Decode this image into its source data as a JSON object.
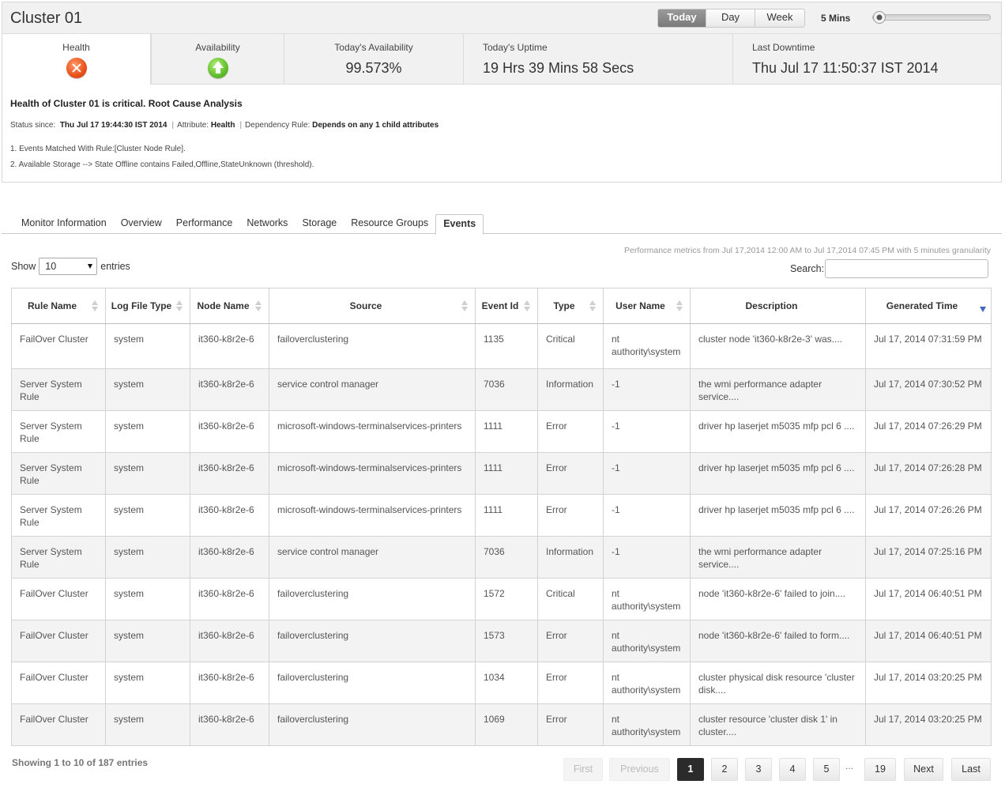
{
  "header": {
    "title": "Cluster 01",
    "range_buttons": [
      {
        "label": "Today"
      },
      {
        "label": "Day"
      },
      {
        "label": "Week"
      }
    ],
    "active_range": "Today",
    "interval": "5 Mins"
  },
  "metrics": {
    "health_label": "Health",
    "health_status": "critical",
    "availability_label": "Availability",
    "availability_status": "up",
    "todays_availability_label": "Today's Availability",
    "todays_availability_value": "99.573%",
    "todays_uptime_label": "Today's Uptime",
    "todays_uptime_value": "19 Hrs 39 Mins 58 Secs",
    "last_downtime_label": "Last Downtime",
    "last_downtime_value": "Thu Jul 17 11:50:37 IST 2014"
  },
  "rca": {
    "title": "Health of Cluster 01 is critical. Root Cause Analysis",
    "status_since_label": "Status since:",
    "status_since_value": "Thu Jul 17 19:44:30 IST 2014",
    "attribute_label": "Attribute:",
    "attribute_value": "Health",
    "dependency_label": "Dependency Rule:",
    "dependency_value": "Depends on any 1 child attributes",
    "lines": [
      "1. Events Matched With Rule:[Cluster Node Rule].",
      "2. Available Storage --> State Offline contains Failed,Offline,StateUnknown (threshold)."
    ]
  },
  "tabs": [
    {
      "label": "Monitor Information"
    },
    {
      "label": "Overview"
    },
    {
      "label": "Performance"
    },
    {
      "label": "Networks"
    },
    {
      "label": "Storage"
    },
    {
      "label": "Resource Groups"
    },
    {
      "label": "Events"
    }
  ],
  "active_tab": "Events",
  "table_controls": {
    "perf_note": "Performance metrics from Jul 17,2014 12:00 AM to Jul 17,2014 07:45 PM with 5 minutes granularity",
    "show_label": "Show",
    "entries_value": "10",
    "entries_label": "entries",
    "search_label": "Search:"
  },
  "columns": [
    {
      "label": "Rule Name"
    },
    {
      "label": "Log File Type"
    },
    {
      "label": "Node Name"
    },
    {
      "label": "Source"
    },
    {
      "label": "Event Id"
    },
    {
      "label": "Type"
    },
    {
      "label": "User Name"
    },
    {
      "label": "Description"
    },
    {
      "label": "Generated Time"
    }
  ],
  "rows": [
    {
      "rule": "FailOver Cluster",
      "logtype": "system",
      "node": "it360-k8r2e-6",
      "source": "failoverclustering",
      "event_id": "1135",
      "type": "Critical",
      "user": "nt authority\\system",
      "description": "cluster node 'it360-k8r2e-3' was....",
      "time": "Jul 17, 2014 07:31:59 PM"
    },
    {
      "rule": "Server System Rule",
      "logtype": "system",
      "node": "it360-k8r2e-6",
      "source": "service control manager",
      "event_id": "7036",
      "type": "Information",
      "user": "-1",
      "description": "the wmi performance adapter service....",
      "time": "Jul 17, 2014 07:30:52 PM"
    },
    {
      "rule": "Server System Rule",
      "logtype": "system",
      "node": "it360-k8r2e-6",
      "source": "microsoft-windows-terminalservices-printers",
      "event_id": "1111",
      "type": "Error",
      "user": "-1",
      "description": "driver hp laserjet m5035 mfp pcl 6 ....",
      "time": "Jul 17, 2014 07:26:29 PM"
    },
    {
      "rule": "Server System Rule",
      "logtype": "system",
      "node": "it360-k8r2e-6",
      "source": "microsoft-windows-terminalservices-printers",
      "event_id": "1111",
      "type": "Error",
      "user": "-1",
      "description": "driver hp laserjet m5035 mfp pcl 6 ....",
      "time": "Jul 17, 2014 07:26:28 PM"
    },
    {
      "rule": "Server System Rule",
      "logtype": "system",
      "node": "it360-k8r2e-6",
      "source": "microsoft-windows-terminalservices-printers",
      "event_id": "1111",
      "type": "Error",
      "user": "-1",
      "description": "driver hp laserjet m5035 mfp pcl 6 ....",
      "time": "Jul 17, 2014 07:26:26 PM"
    },
    {
      "rule": "Server System Rule",
      "logtype": "system",
      "node": "it360-k8r2e-6",
      "source": "service control manager",
      "event_id": "7036",
      "type": "Information",
      "user": "-1",
      "description": "the wmi performance adapter service....",
      "time": "Jul 17, 2014 07:25:16 PM"
    },
    {
      "rule": "FailOver Cluster",
      "logtype": "system",
      "node": "it360-k8r2e-6",
      "source": "failoverclustering",
      "event_id": "1572",
      "type": "Critical",
      "user": "nt authority\\system",
      "description": "node 'it360-k8r2e-6' failed to join....",
      "time": "Jul 17, 2014 06:40:51 PM"
    },
    {
      "rule": "FailOver Cluster",
      "logtype": "system",
      "node": "it360-k8r2e-6",
      "source": "failoverclustering",
      "event_id": "1573",
      "type": "Error",
      "user": "nt authority\\system",
      "description": "node 'it360-k8r2e-6' failed to form....",
      "time": "Jul 17, 2014 06:40:51 PM"
    },
    {
      "rule": "FailOver Cluster",
      "logtype": "system",
      "node": "it360-k8r2e-6",
      "source": "failoverclustering",
      "event_id": "1034",
      "type": "Error",
      "user": "nt authority\\system",
      "description": "cluster physical disk resource 'cluster disk....",
      "time": "Jul 17, 2014 03:20:25 PM"
    },
    {
      "rule": "FailOver Cluster",
      "logtype": "system",
      "node": "it360-k8r2e-6",
      "source": "failoverclustering",
      "event_id": "1069",
      "type": "Error",
      "user": "nt authority\\system",
      "description": "cluster resource 'cluster disk 1' in cluster....",
      "time": "Jul 17, 2014 03:20:25 PM"
    }
  ],
  "pagination": {
    "info": "Showing 1 to 10 of 187 entries",
    "first": "First",
    "previous": "Previous",
    "pages": [
      "1",
      "2",
      "3",
      "4",
      "5"
    ],
    "current_page": "1",
    "ellipsis": "...",
    "last_page": "19",
    "next": "Next",
    "last": "Last"
  },
  "colors": {
    "critical_icon": "#e8501a",
    "up_icon": "#5fbf2a",
    "sort_active": "#4466bb",
    "current_page_bg": "#2b2b2b"
  },
  "icons": {
    "health": "critical-x-icon",
    "availability": "up-arrow-icon",
    "entries_select": "caret-down-icon"
  }
}
